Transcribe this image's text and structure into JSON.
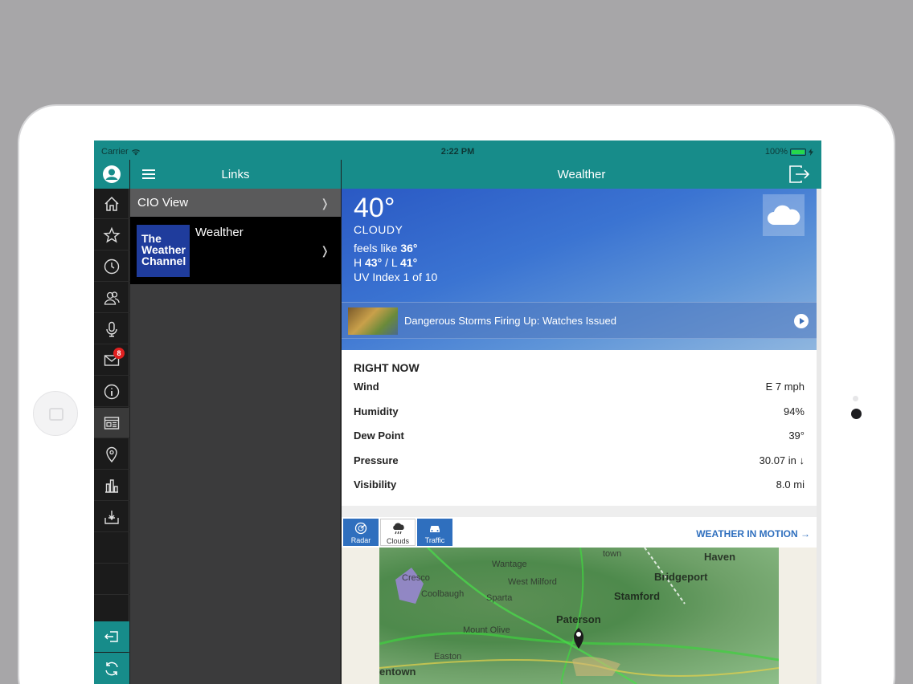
{
  "status_bar": {
    "carrier": "Carrier",
    "time": "2:22 PM",
    "battery": "100%"
  },
  "links_panel": {
    "title": "Links",
    "items": [
      {
        "label": "CIO View"
      },
      {
        "label": "Wealther",
        "logo_text": [
          "The",
          "Weather",
          "Channel"
        ]
      }
    ]
  },
  "rail": {
    "items": [
      "avatar-icon",
      "home-icon",
      "star-icon",
      "clock-icon",
      "contacts-icon",
      "microphone-icon",
      "mail-icon",
      "info-icon",
      "news-icon",
      "location-pin-icon",
      "bar-chart-icon",
      "download-tray-icon"
    ],
    "mail_badge": "8",
    "bottom": [
      "logout-icon",
      "refresh-icon"
    ]
  },
  "content": {
    "title": "Wealther",
    "current": {
      "temp": "40°",
      "condition": "CLOUDY",
      "feels_label": "feels like",
      "feels_value": "36°",
      "hi_lo_label_h": "H",
      "hi": "43°",
      "lo_label": "/ L",
      "lo": "41°",
      "uv": "UV Index 1 of 10"
    },
    "news": {
      "headline": "Dangerous Storms Firing Up: Watches Issued"
    },
    "right_now": {
      "title": "RIGHT NOW",
      "rows": [
        {
          "label": "Wind",
          "value": "E 7 mph"
        },
        {
          "label": "Humidity",
          "value": "94%"
        },
        {
          "label": "Dew Point",
          "value": "39°"
        },
        {
          "label": "Pressure",
          "value": "30.07 in ↓"
        },
        {
          "label": "Visibility",
          "value": "8.0 mi"
        }
      ]
    },
    "map": {
      "tabs": [
        {
          "label": "Radar"
        },
        {
          "label": "Clouds"
        },
        {
          "label": "Traffic"
        }
      ],
      "link": "WEATHER IN MOTION →",
      "place_labels": [
        "Cresco",
        "Coolbaugh",
        "Sparta",
        "West Milford",
        "Wantage",
        "Bridgeport",
        "Stamford",
        "Paterson",
        "Mount Olive",
        "Easton",
        "entown",
        "Haven",
        "town"
      ]
    }
  },
  "colors": {
    "teal": "#178c8a",
    "rail_dark": "#1b1b1b",
    "links_bg": "#3b3b3c",
    "accent_blue": "#2f6fbe",
    "badge_red": "#e02020"
  }
}
